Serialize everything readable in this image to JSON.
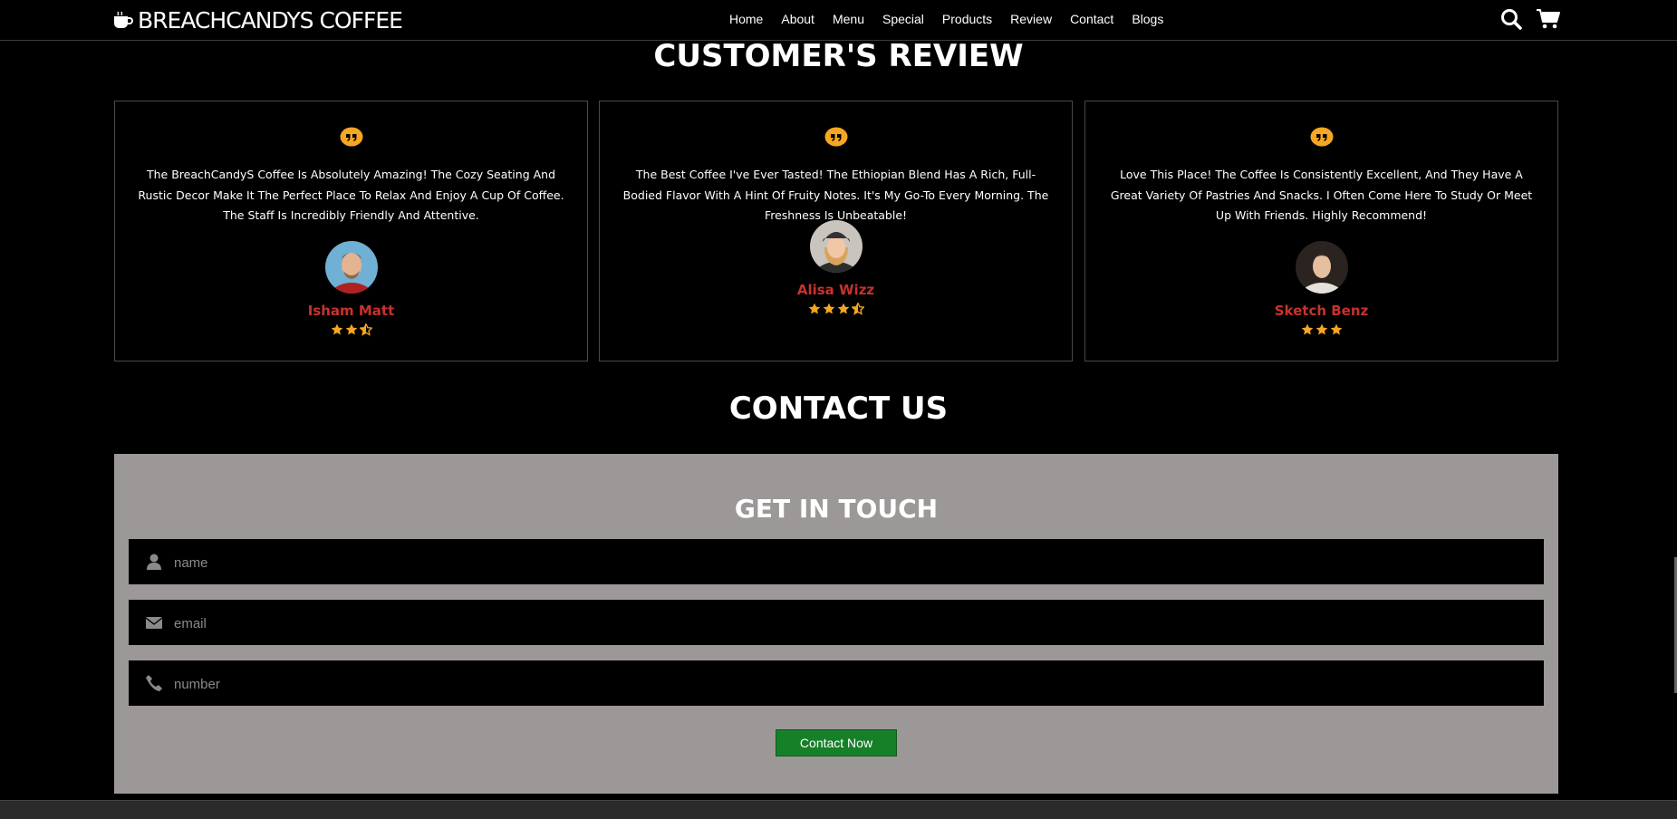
{
  "header": {
    "logo_text": "BREACHCANDYS COFFEE",
    "nav": [
      "Home",
      "About",
      "Menu",
      "Special",
      "Products",
      "Review",
      "Contact",
      "Blogs"
    ]
  },
  "reviews": {
    "title": "CUSTOMER'S REVIEW",
    "items": [
      {
        "text": "The BreachCandyS Coffee Is Absolutely Amazing! The Cozy Seating And Rustic Decor Make It The Perfect Place To Relax And Enjoy A Cup Of Coffee. The Staff Is Incredibly Friendly And Attentive.",
        "name": "Isham Matt",
        "rating": 2.5
      },
      {
        "text": "The Best Coffee I've Ever Tasted! The Ethiopian Blend Has A Rich, Full-Bodied Flavor With A Hint Of Fruity Notes. It's My Go-To Every Morning. The Freshness Is Unbeatable!",
        "name": "Alisa Wizz",
        "rating": 3.5
      },
      {
        "text": "Love This Place! The Coffee Is Consistently Excellent, And They Have A Great Variety Of Pastries And Snacks. I Often Come Here To Study Or Meet Up With Friends. Highly Recommend!",
        "name": "Sketch Benz",
        "rating": 3
      }
    ]
  },
  "contact": {
    "title": "CONTACT US",
    "subtitle": "GET IN TOUCH",
    "name_placeholder": "name",
    "email_placeholder": "email",
    "number_placeholder": "number",
    "button": "Contact Now"
  },
  "colors": {
    "accent": "#f5a623",
    "name": "#c8322e",
    "button": "#168029",
    "panel": "#9d9898"
  }
}
